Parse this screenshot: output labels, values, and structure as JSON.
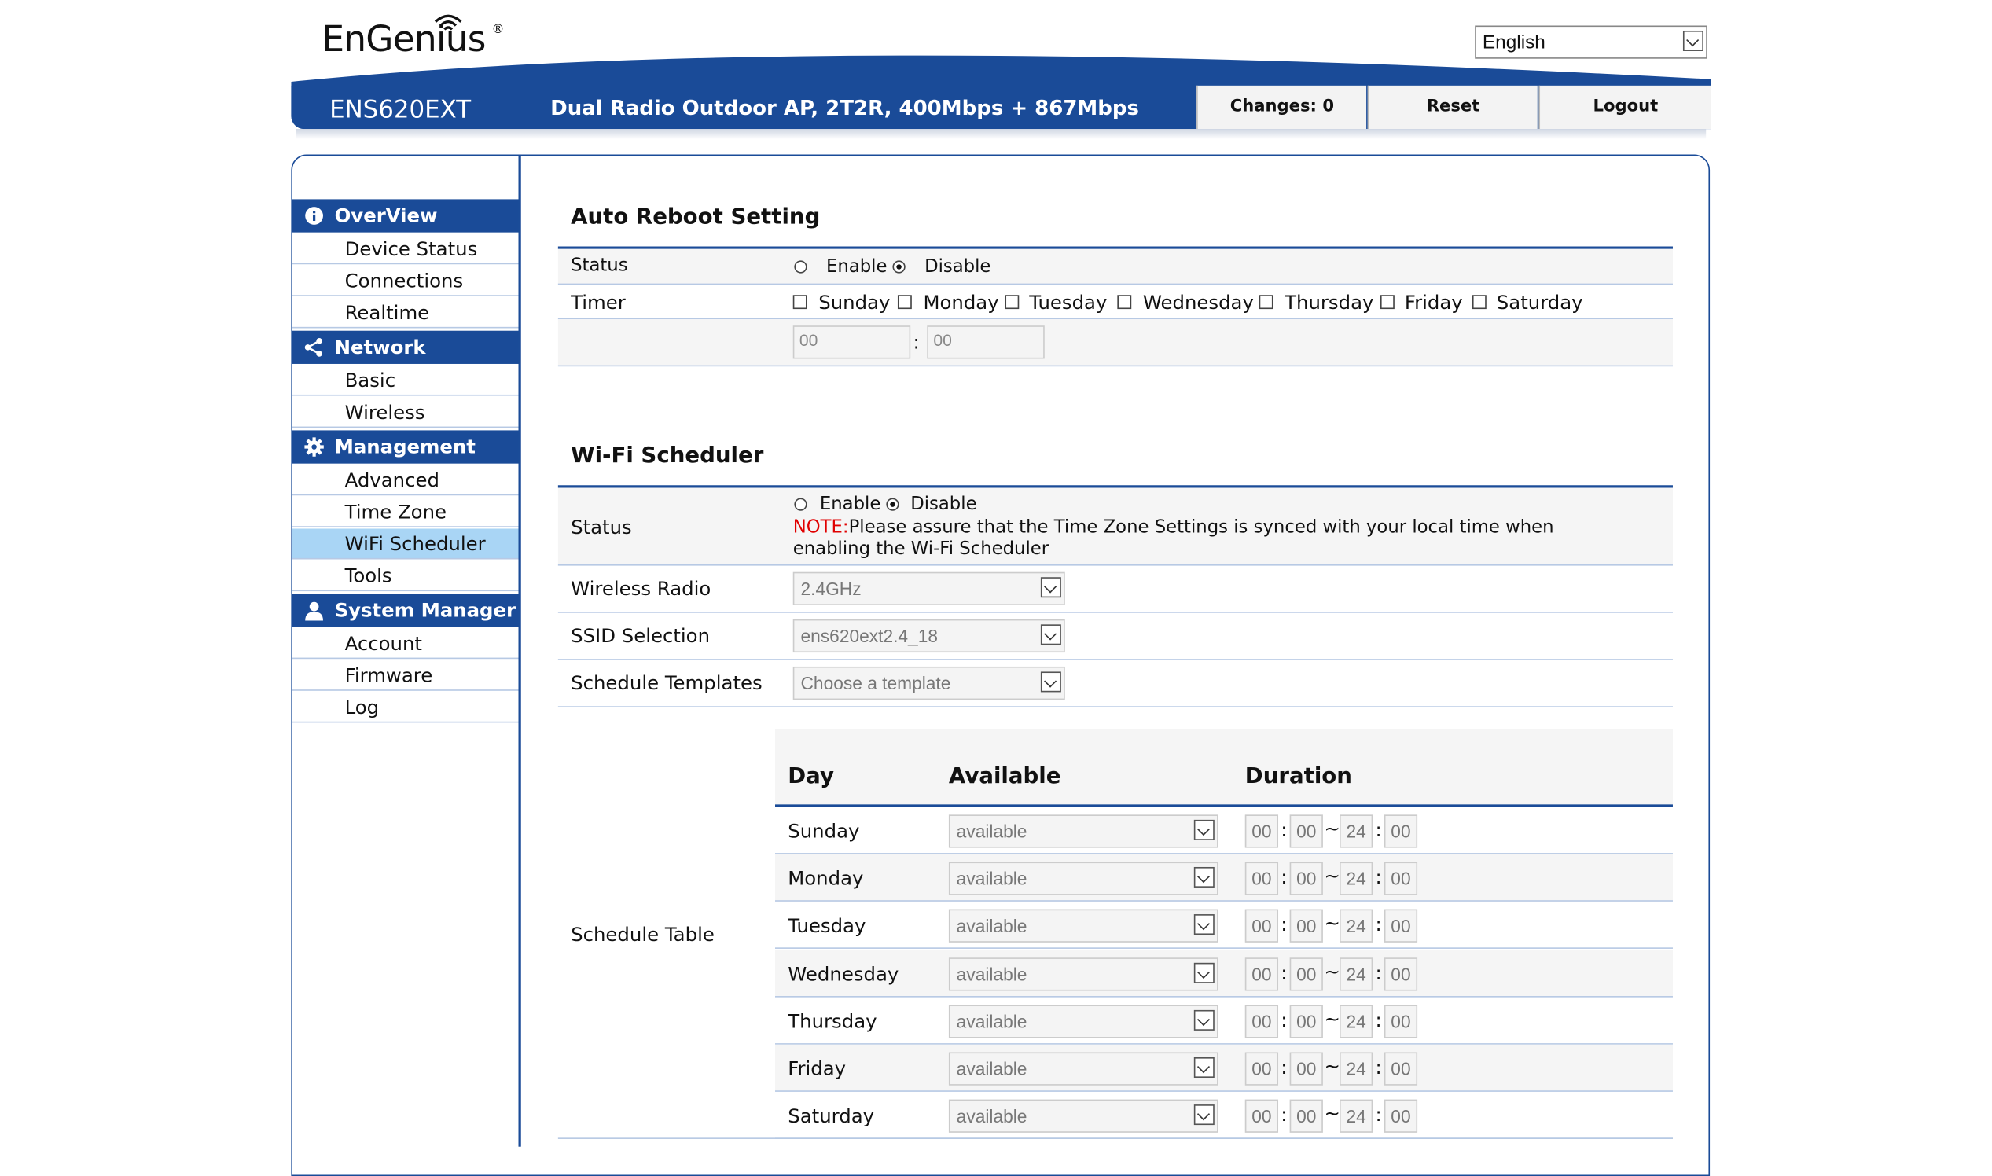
{
  "header": {
    "brand": "EnGenius",
    "brand_mark": "®",
    "language": "English",
    "model": "ENS620EXT",
    "description": "Dual Radio Outdoor AP, 2T2R, 400Mbps + 867Mbps",
    "changes_label": "Changes: 0",
    "reset_label": "Reset",
    "logout_label": "Logout"
  },
  "sidebar": {
    "groups": [
      {
        "label": "OverView",
        "icon": "info-icon",
        "items": [
          "Device Status",
          "Connections",
          "Realtime"
        ]
      },
      {
        "label": "Network",
        "icon": "share-icon",
        "items": [
          "Basic",
          "Wireless"
        ]
      },
      {
        "label": "Management",
        "icon": "gear-icon",
        "items": [
          "Advanced",
          "Time Zone",
          "WiFi Scheduler",
          "Tools"
        ]
      },
      {
        "label": "System Manager",
        "icon": "user-icon",
        "items": [
          "Account",
          "Firmware",
          "Log"
        ]
      }
    ],
    "active_item": "WiFi Scheduler"
  },
  "auto_reboot": {
    "title": "Auto Reboot Setting",
    "status_label": "Status",
    "enable_label": "Enable",
    "disable_label": "Disable",
    "status_value": "Disable",
    "timer_label": "Timer",
    "days": [
      "Sunday",
      "Monday",
      "Tuesday",
      "Wednesday",
      "Thursday",
      "Friday",
      "Saturday"
    ],
    "hour_placeholder": "00",
    "minute_placeholder": "00",
    "time_sep": ":"
  },
  "wifi_scheduler": {
    "title": "Wi-Fi Scheduler",
    "status_label": "Status",
    "enable_label": "Enable",
    "disable_label": "Disable",
    "status_value": "Disable",
    "note_prefix": "NOTE:",
    "note_text": "Please assure that the Time Zone Settings is synced with your local time when",
    "note_text2": "enabling the Wi-Fi Scheduler",
    "wireless_radio_label": "Wireless Radio",
    "wireless_radio_value": "2.4GHz",
    "ssid_label": "SSID Selection",
    "ssid_value": "ens620ext2.4_18",
    "templates_label": "Schedule Templates",
    "templates_value": "Choose a template",
    "table_label": "Schedule Table",
    "table_headers": {
      "day": "Day",
      "available": "Available",
      "duration": "Duration"
    },
    "rows": [
      {
        "day": "Sunday",
        "available": "available",
        "start_h": "00",
        "start_m": "00",
        "end_h": "24",
        "end_m": "00"
      },
      {
        "day": "Monday",
        "available": "available",
        "start_h": "00",
        "start_m": "00",
        "end_h": "24",
        "end_m": "00"
      },
      {
        "day": "Tuesday",
        "available": "available",
        "start_h": "00",
        "start_m": "00",
        "end_h": "24",
        "end_m": "00"
      },
      {
        "day": "Wednesday",
        "available": "available",
        "start_h": "00",
        "start_m": "00",
        "end_h": "24",
        "end_m": "00"
      },
      {
        "day": "Thursday",
        "available": "available",
        "start_h": "00",
        "start_m": "00",
        "end_h": "24",
        "end_m": "00"
      },
      {
        "day": "Friday",
        "available": "available",
        "start_h": "00",
        "start_m": "00",
        "end_h": "24",
        "end_m": "00"
      },
      {
        "day": "Saturday",
        "available": "available",
        "start_h": "00",
        "start_m": "00",
        "end_h": "24",
        "end_m": "00"
      }
    ],
    "colon": ":",
    "tilde": "~"
  },
  "colors": {
    "brand_blue": "#1a4b98",
    "active_nav": "#a9d5f5",
    "note_red": "#e00000"
  }
}
